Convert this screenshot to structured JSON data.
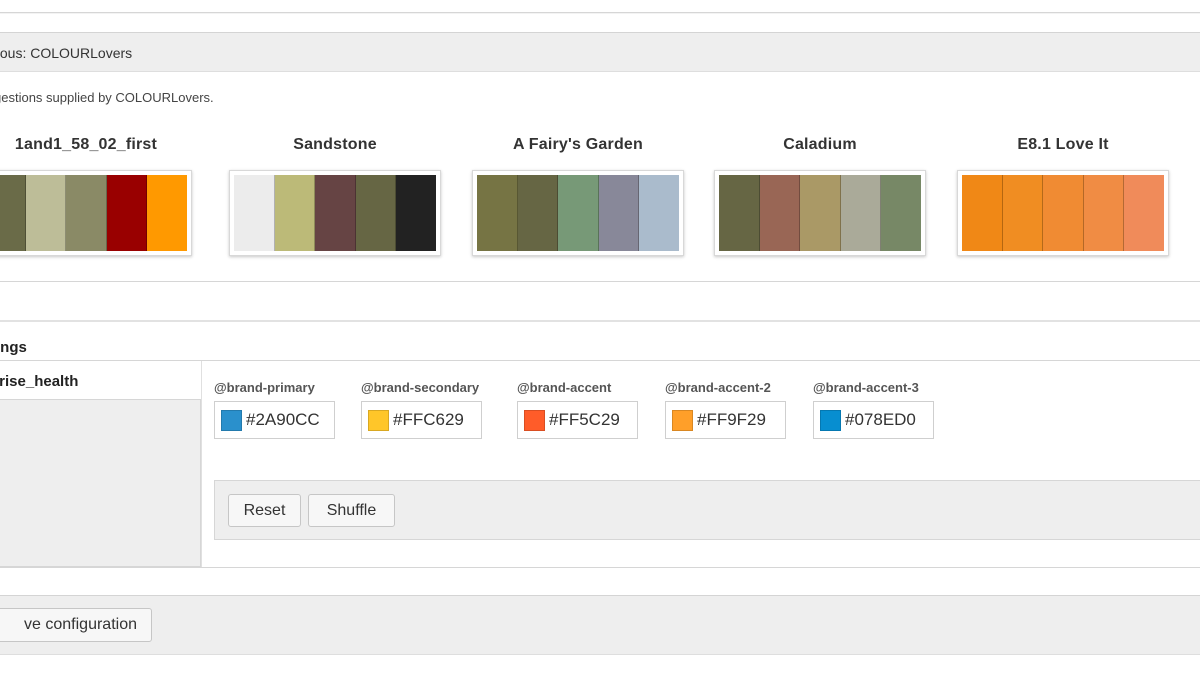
{
  "header": {
    "title": "culous: COLOURLovers"
  },
  "suggestions_text": "gestions supplied by COLOURLovers.",
  "palettes": [
    {
      "name": "1and1_58_02_first",
      "colors": [
        "#6a6b48",
        "#bdbd98",
        "#8a8a66",
        "#990000",
        "#ff9900"
      ]
    },
    {
      "name": "Sandstone",
      "colors": [
        "#ececec",
        "#bcba78",
        "#664444",
        "#666644",
        "#222222"
      ]
    },
    {
      "name": "A Fairy's Garden",
      "colors": [
        "#767444",
        "#666644",
        "#779977",
        "#888899",
        "#aabbcc"
      ]
    },
    {
      "name": "Caladium",
      "colors": [
        "#666644",
        "#996655",
        "#aa9966",
        "#aaaa99",
        "#778866"
      ]
    },
    {
      "name": "E8.1 Love It",
      "colors": [
        "#f08816",
        "#f08d22",
        "#f08b33",
        "#f08c44",
        "#f08b5a"
      ]
    }
  ],
  "settings": {
    "title": "ttings",
    "theme_name": "prise_health",
    "variables": [
      {
        "label": "@brand-primary",
        "value": "#2A90CC",
        "color": "#2A90CC"
      },
      {
        "label": "@brand-secondary",
        "value": "#FFC629",
        "color": "#FFC629"
      },
      {
        "label": "@brand-accent",
        "value": "#FF5C29",
        "color": "#FF5C29"
      },
      {
        "label": "@brand-accent-2",
        "value": "#FF9F29",
        "color": "#FF9F29"
      },
      {
        "label": "@brand-accent-3",
        "value": "#078ED0",
        "color": "#078ED0"
      }
    ],
    "reset_label": "Reset",
    "shuffle_label": "Shuffle"
  },
  "footer": {
    "save_label": "ve configuration"
  }
}
